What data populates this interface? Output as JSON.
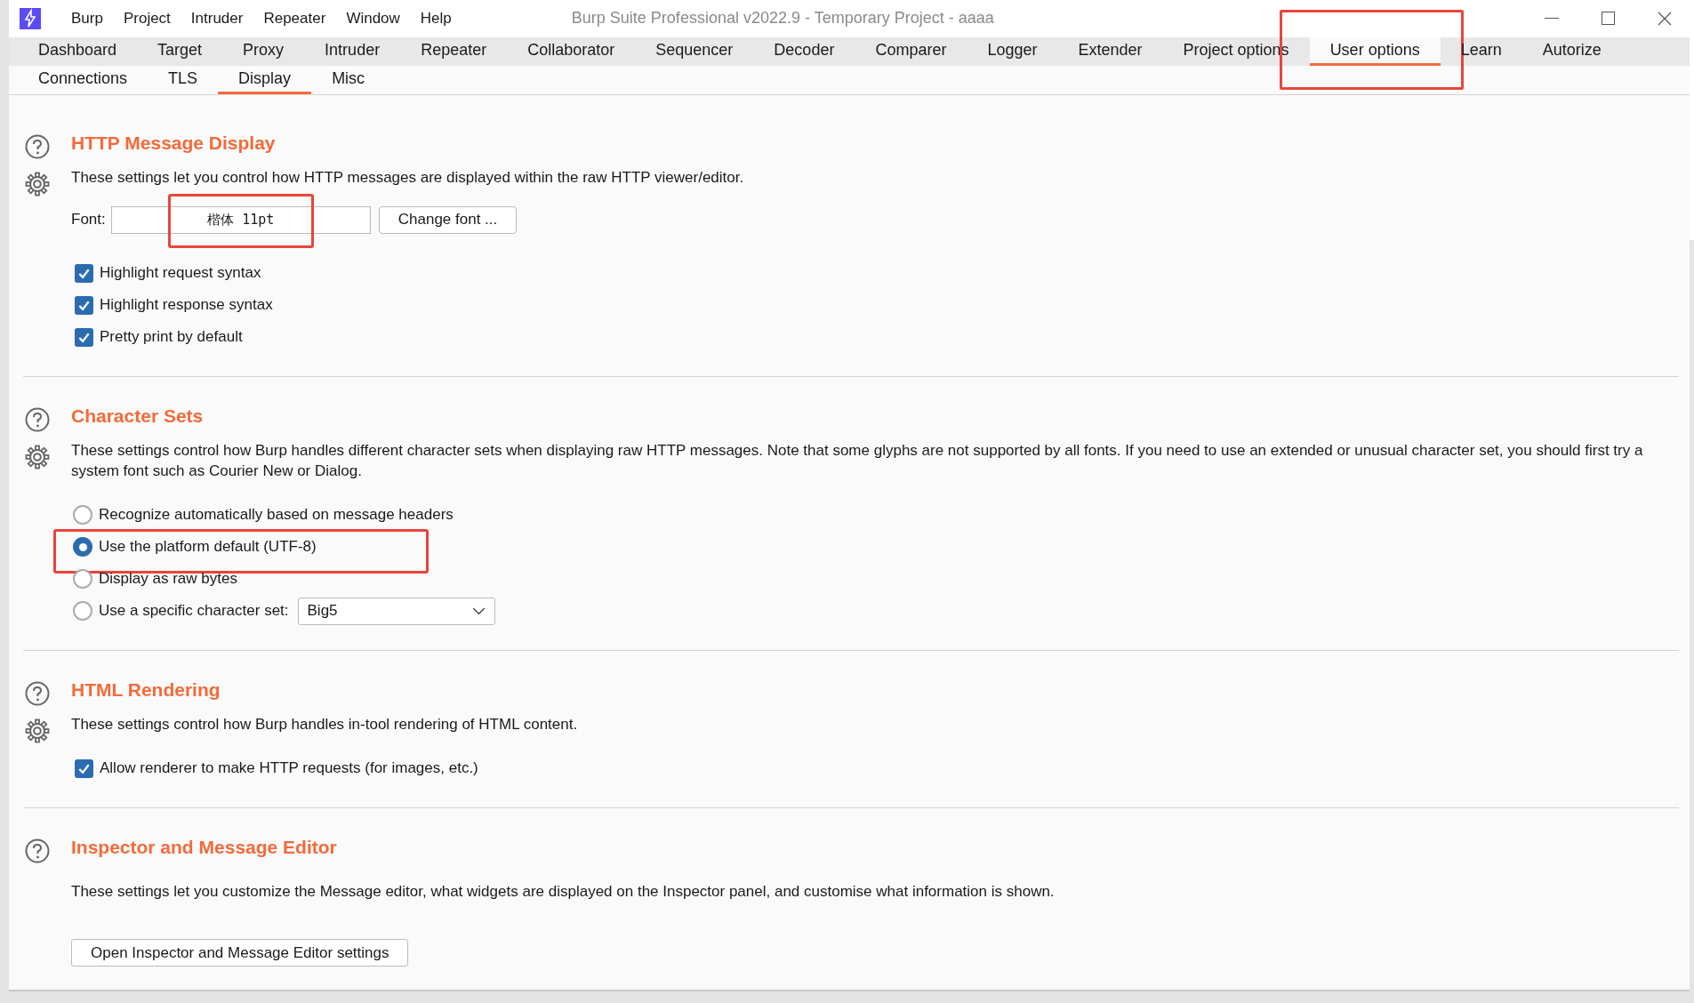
{
  "window": {
    "title": "Burp Suite Professional v2022.9 - Temporary Project - aaaa"
  },
  "menu": [
    "Burp",
    "Project",
    "Intruder",
    "Repeater",
    "Window",
    "Help"
  ],
  "tabs": [
    {
      "label": "Dashboard",
      "selected": false,
      "highlighted": false
    },
    {
      "label": "Target",
      "selected": false,
      "highlighted": false
    },
    {
      "label": "Proxy",
      "selected": false,
      "highlighted": false
    },
    {
      "label": "Intruder",
      "selected": false,
      "highlighted": false
    },
    {
      "label": "Repeater",
      "selected": false,
      "highlighted": false
    },
    {
      "label": "Collaborator",
      "selected": false,
      "highlighted": false
    },
    {
      "label": "Sequencer",
      "selected": false,
      "highlighted": false
    },
    {
      "label": "Decoder",
      "selected": false,
      "highlighted": false
    },
    {
      "label": "Comparer",
      "selected": false,
      "highlighted": false
    },
    {
      "label": "Logger",
      "selected": false,
      "highlighted": false
    },
    {
      "label": "Extender",
      "selected": false,
      "highlighted": false
    },
    {
      "label": "Project options",
      "selected": false,
      "highlighted": false
    },
    {
      "label": "User options",
      "selected": true,
      "highlighted": true
    },
    {
      "label": "Learn",
      "selected": false,
      "highlighted": false
    },
    {
      "label": "Autorize",
      "selected": false,
      "highlighted": false
    }
  ],
  "subtabs": [
    {
      "label": "Connections",
      "selected": false
    },
    {
      "label": "TLS",
      "selected": false
    },
    {
      "label": "Display",
      "selected": true
    },
    {
      "label": "Misc",
      "selected": false
    }
  ],
  "sections": [
    {
      "title": "HTTP Message Display",
      "settings_icon": true,
      "description": "These settings let you control how HTTP messages are displayed within the raw HTTP viewer/editor.",
      "items": [
        {
          "kind": "font",
          "label": "Font:",
          "value": "楷体 11pt",
          "button": "Change font ...",
          "highlighted": true
        },
        {
          "kind": "checkbox",
          "label": "Highlight request syntax",
          "checked": true
        },
        {
          "kind": "checkbox",
          "label": "Highlight response syntax",
          "checked": true
        },
        {
          "kind": "checkbox",
          "label": "Pretty print by default",
          "checked": true
        }
      ]
    },
    {
      "title": "Character Sets",
      "settings_icon": true,
      "description": "These settings control how Burp handles different character sets when displaying raw HTTP messages. Note that some glyphs are not supported by all fonts. If you need to use an extended or unusual character set, you should first try a system font such as Courier New or Dialog.",
      "items": [
        {
          "kind": "radio",
          "label": "Recognize automatically based on message headers",
          "selected": false,
          "highlighted": false
        },
        {
          "kind": "radio",
          "label": "Use the platform default (UTF-8)",
          "selected": true,
          "highlighted": true
        },
        {
          "kind": "radio",
          "label": "Display as raw bytes",
          "selected": false,
          "highlighted": false
        },
        {
          "kind": "radio",
          "label": "Use a specific character set:",
          "selected": false,
          "highlighted": false,
          "dropdown": "Big5"
        }
      ]
    },
    {
      "title": "HTML Rendering",
      "settings_icon": true,
      "description": "These settings control how Burp handles in-tool rendering of HTML content.",
      "items": [
        {
          "kind": "checkbox",
          "label": "Allow renderer to make HTTP requests (for images, etc.)",
          "checked": true
        }
      ]
    },
    {
      "title": "Inspector and Message Editor",
      "settings_icon": false,
      "description": "These settings let you customize the Message editor, what widgets are displayed on the Inspector panel, and customise what information is shown.",
      "items": [
        {
          "kind": "button",
          "label": "Open Inspector and Message Editor settings"
        }
      ]
    }
  ]
}
